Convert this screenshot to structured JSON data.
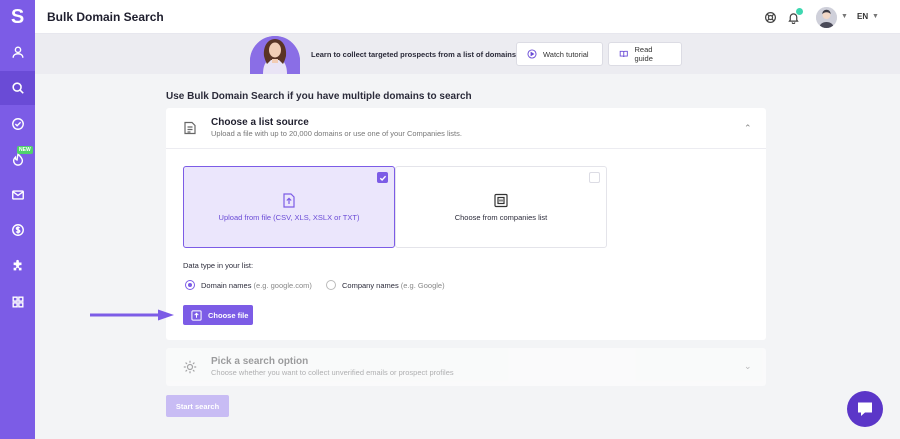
{
  "app": {
    "logo_letter": "S",
    "page_title": "Bulk Domain Search",
    "new_badge": "NEW"
  },
  "header": {
    "language": "EN"
  },
  "banner": {
    "text": "Learn to collect targeted prospects from a list of domains",
    "watch_label": "Watch tutorial",
    "guide_label": "Read guide"
  },
  "main": {
    "section_title": "Use Bulk Domain Search if you have multiple domains to search",
    "step1": {
      "title": "Choose a list source",
      "subtitle": "Upload a file with up to 20,000 domains or use one of your Companies lists.",
      "upload_label": "Upload from file (CSV, XLS, XSLX or TXT)",
      "companies_label": "Choose from companies list",
      "data_type_label": "Data type in your list:",
      "radio1_label": "Domain names",
      "radio1_hint": "(e.g. google.com)",
      "radio2_label": "Company names",
      "radio2_hint": "(e.g. Google)",
      "choose_file_label": "Choose file"
    },
    "step2": {
      "title": "Pick a search option",
      "subtitle": "Choose whether you want to collect unverified emails or prospect profiles"
    },
    "start_label": "Start search"
  },
  "colors": {
    "accent": "#7c5ce6",
    "sidebar": "#7c5ce6",
    "chat": "#5b36c8"
  }
}
